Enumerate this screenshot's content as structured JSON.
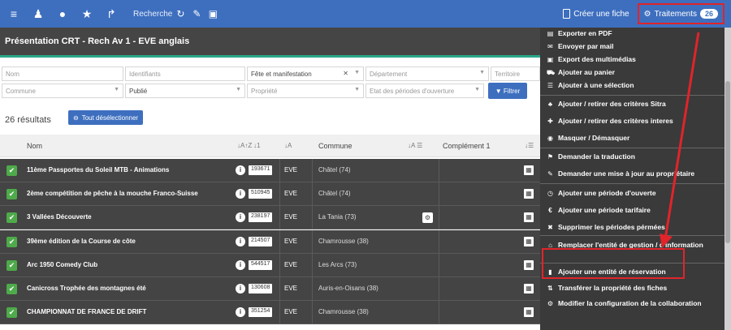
{
  "topbar": {
    "search_label": "Recherche",
    "create_label": "Créer une fiche",
    "traitements_label": "Traitements",
    "traitements_count": "26"
  },
  "page": {
    "title": "Présentation CRT - Rech Av 1 - EVE anglais"
  },
  "filters": {
    "nom_placeholder": "Nom",
    "identifiants_placeholder": "Identifiants",
    "fete_value": "Fête et manifestation",
    "departement_placeholder": "Département",
    "territoire_placeholder": "Territoire",
    "commune_placeholder": "Commune",
    "publie_value": "Publié",
    "propriete_placeholder": "Propriété",
    "etat_placeholder": "Etat des périodes d'ouverture",
    "filtrer_label": "Filtrer"
  },
  "results": {
    "count_label": "26 résultats",
    "deselect_label": "Tout désélectionner"
  },
  "table": {
    "col_nom": "Nom",
    "col_commune": "Commune",
    "col_complement": "Complément 1",
    "rows": [
      {
        "name": "11ème Passportes du Soleil MTB - Animations",
        "id": "193671",
        "code": "EVE",
        "commune": "Châtel (74)",
        "gear": false
      },
      {
        "name": "2ème compétition de pêche à la mouche Franco-Suisse",
        "id": "510945",
        "code": "EVE",
        "commune": "Châtel (74)",
        "gear": false
      },
      {
        "name": "3 Vallées Découverte",
        "id": "238197",
        "code": "EVE",
        "commune": "La Tania (73)",
        "gear": true
      },
      {
        "name": "39ème édition de la Course de côte",
        "id": "214507",
        "code": "EVE",
        "commune": "Chamrousse (38)",
        "gear": false
      },
      {
        "name": "Arc 1950 Comedy Club",
        "id": "544517",
        "code": "EVE",
        "commune": "Les Arcs (73)",
        "gear": false
      },
      {
        "name": "Canicross Trophée des montagnes été",
        "id": "130608",
        "code": "EVE",
        "commune": "Auris-en-Oisans (38)",
        "gear": false
      },
      {
        "name": "CHAMPIONNAT DE FRANCE DE DRIFT",
        "id": "351254",
        "code": "EVE",
        "commune": "Chamrousse (38)",
        "gear": false
      }
    ]
  },
  "menu": {
    "items": [
      {
        "icon": "pdf-icon",
        "glyph": "▤",
        "label": "Exporter en PDF"
      },
      {
        "icon": "envelope-icon",
        "glyph": "✉",
        "label": "Envoyer par mail"
      },
      {
        "icon": "image-icon",
        "glyph": "▣",
        "label": "Export des multimédias"
      },
      {
        "icon": "cart-icon",
        "glyph": "⛟",
        "label": "Ajouter au panier"
      },
      {
        "icon": "list-icon",
        "glyph": "☰",
        "label": "Ajouter à une sélection"
      },
      {
        "icon": "sitemap-icon",
        "glyph": "♣",
        "label": "Ajouter / retirer des critères Sitra"
      },
      {
        "icon": "pin-icon",
        "glyph": "✚",
        "label": "Ajouter / retirer des critères interes"
      },
      {
        "icon": "eye-icon",
        "glyph": "◉",
        "label": "Masquer / Démasquer"
      },
      {
        "icon": "flag-icon",
        "glyph": "⚑",
        "label": "Demander la traduction"
      },
      {
        "icon": "edit-icon",
        "glyph": "✎",
        "label": "Demander une mise à jour au propriétaire"
      },
      {
        "icon": "clock-icon",
        "glyph": "◷",
        "label": "Ajouter une période d'ouverte"
      },
      {
        "icon": "euro-icon",
        "glyph": "€",
        "label": "Ajouter une période tarifaire"
      },
      {
        "icon": "trash-icon",
        "glyph": "✖",
        "label": "Supprimer les périodes pérmées"
      },
      {
        "icon": "home-icon",
        "glyph": "⌂",
        "label": "Remplacer l'entité de gestion / d'information"
      },
      {
        "icon": "briefcase-icon",
        "glyph": "▮",
        "label": "Ajouter une entité de réservation"
      },
      {
        "icon": "transfer-icon",
        "glyph": "⇅",
        "label": "Transférer la propriété des fiches"
      },
      {
        "icon": "cogs-icon",
        "glyph": "⚙",
        "label": "Modifier la configuration de la collaboration"
      }
    ]
  },
  "colors": {
    "topbar": "#3e6fbf",
    "menu_bg": "#3a3a3a",
    "row_bg": "#444444",
    "check": "#4eaa4a",
    "highlight": "#e0242a",
    "accent_green": "#2aa88a"
  }
}
